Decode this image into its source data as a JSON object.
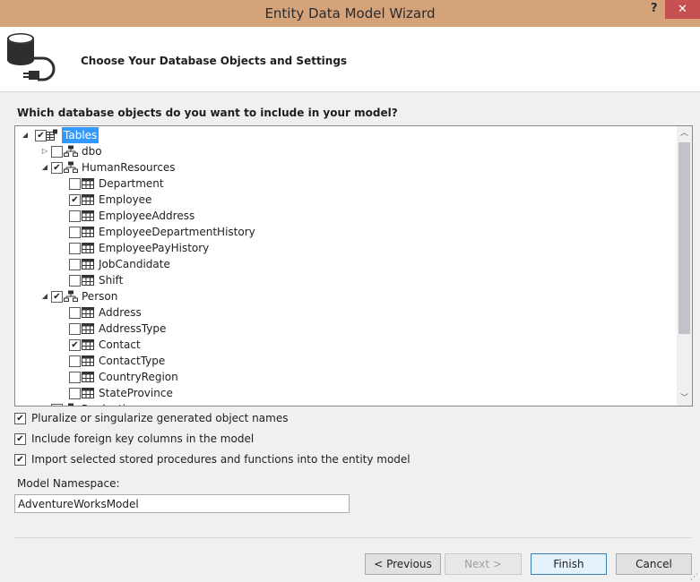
{
  "window": {
    "title": "Entity Data Model Wizard",
    "help": "?",
    "close": "✕"
  },
  "header": {
    "heading": "Choose Your Database Objects and Settings"
  },
  "question": "Which database objects do you want to include in your model?",
  "tree": {
    "rows": [
      {
        "label": "Tables",
        "level": 0,
        "expander": "◢",
        "checked": true,
        "icon": "tables",
        "selected": true
      },
      {
        "label": "dbo",
        "level": 1,
        "expander": "▷",
        "checked": false,
        "icon": "schema"
      },
      {
        "label": "HumanResources",
        "level": 1,
        "expander": "◢",
        "checked": true,
        "icon": "schema"
      },
      {
        "label": "Department",
        "level": 2,
        "checked": false,
        "icon": "table"
      },
      {
        "label": "Employee",
        "level": 2,
        "checked": true,
        "icon": "table"
      },
      {
        "label": "EmployeeAddress",
        "level": 2,
        "checked": false,
        "icon": "table"
      },
      {
        "label": "EmployeeDepartmentHistory",
        "level": 2,
        "checked": false,
        "icon": "table"
      },
      {
        "label": "EmployeePayHistory",
        "level": 2,
        "checked": false,
        "icon": "table"
      },
      {
        "label": "JobCandidate",
        "level": 2,
        "checked": false,
        "icon": "table"
      },
      {
        "label": "Shift",
        "level": 2,
        "checked": false,
        "icon": "table"
      },
      {
        "label": "Person",
        "level": 1,
        "expander": "◢",
        "checked": true,
        "icon": "schema"
      },
      {
        "label": "Address",
        "level": 2,
        "checked": false,
        "icon": "table"
      },
      {
        "label": "AddressType",
        "level": 2,
        "checked": false,
        "icon": "table"
      },
      {
        "label": "Contact",
        "level": 2,
        "checked": true,
        "icon": "table"
      },
      {
        "label": "ContactType",
        "level": 2,
        "checked": false,
        "icon": "table"
      },
      {
        "label": "CountryRegion",
        "level": 2,
        "checked": false,
        "icon": "table"
      },
      {
        "label": "StateProvince",
        "level": 2,
        "checked": false,
        "icon": "table"
      },
      {
        "label": "Production",
        "level": 1,
        "expander": "▷",
        "checked": false,
        "icon": "schema"
      }
    ]
  },
  "options": [
    {
      "label": "Pluralize or singularize generated object names",
      "checked": true
    },
    {
      "label": "Include foreign key columns in the model",
      "checked": true
    },
    {
      "label": "Import selected stored procedures and functions into the entity model",
      "checked": true
    }
  ],
  "namespace": {
    "label": "Model Namespace:",
    "value": "AdventureWorksModel"
  },
  "buttons": {
    "previous": "< Previous",
    "next": "Next >",
    "finish": "Finish",
    "cancel": "Cancel"
  },
  "colors": {
    "titlebar": "#d4a37a",
    "close": "#c75050",
    "selection": "#3399ff"
  }
}
